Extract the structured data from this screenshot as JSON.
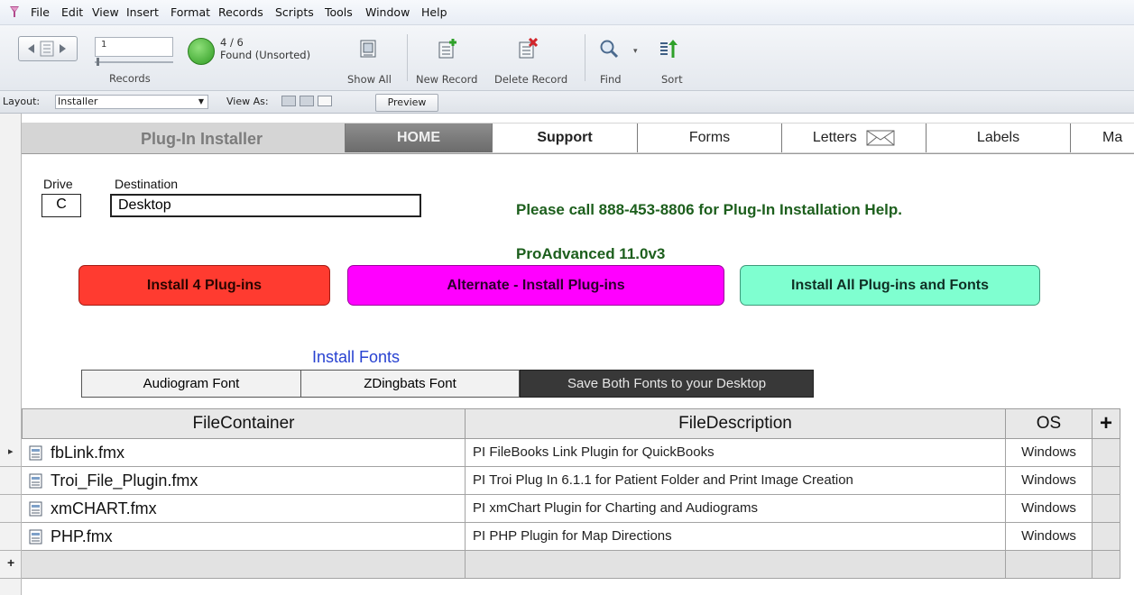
{
  "menu": [
    "File",
    "Edit",
    "View",
    "Insert",
    "Format",
    "Records",
    "Scripts",
    "Tools",
    "Window",
    "Help"
  ],
  "toolbar": {
    "record_number": "1",
    "records_label": "Records",
    "found_count": "4 / 6",
    "found_status": "Found (Unsorted)",
    "buttons": [
      {
        "label": "Show All",
        "icon": "show-all-icon"
      },
      {
        "label": "New Record",
        "icon": "new-record-icon"
      },
      {
        "label": "Delete Record",
        "icon": "delete-record-icon"
      },
      {
        "label": "Find",
        "icon": "find-icon"
      },
      {
        "label": "Sort",
        "icon": "sort-icon"
      }
    ]
  },
  "layoutbar": {
    "layout_label": "Layout:",
    "layout_value": "Installer",
    "view_as_label": "View As:",
    "preview_label": "Preview"
  },
  "nav": {
    "title": "Plug-In Installer",
    "tabs": [
      "HOME",
      "Support",
      "Forms",
      "Letters",
      "Labels",
      "Ma"
    ]
  },
  "form": {
    "drive_label": "Drive",
    "drive_value": "C",
    "destination_label": "Destination",
    "destination_value": "Desktop",
    "help_text": "Please call 888-453-8806 for Plug-In Installation Help.",
    "version": "ProAdvanced 11.0v3"
  },
  "actions": {
    "install4": "Install 4 Plug-ins",
    "alternate": "Alternate - Install Plug-ins",
    "install_all": "Install All Plug-ins and Fonts",
    "colors": {
      "install4": "#ff3b30",
      "alternate": "#ff00ff",
      "install_all": "#7fffd0"
    }
  },
  "fonts": {
    "heading": "Install Fonts",
    "buttons": [
      "Audiogram Font",
      "ZDingbats Font",
      "Save Both Fonts to your Desktop"
    ]
  },
  "table": {
    "headers": [
      "FileContainer",
      "FileDescription",
      "OS",
      "+"
    ],
    "rows": [
      {
        "file": "fbLink.fmx",
        "description": "PI FileBooks Link Plugin for QuickBooks",
        "os": "Windows"
      },
      {
        "file": "Troi_File_Plugin.fmx",
        "description": "PI Troi Plug In 6.1.1 for Patient Folder and Print Image Creation",
        "os": "Windows"
      },
      {
        "file": "xmCHART.fmx",
        "description": "PI xmChart Plugin for Charting and Audiograms",
        "os": "Windows"
      },
      {
        "file": "PHP.fmx",
        "description": "PI PHP Plugin for Map Directions",
        "os": "Windows"
      }
    ],
    "new_row_marker": "+",
    "current_row_marker": "▸"
  }
}
